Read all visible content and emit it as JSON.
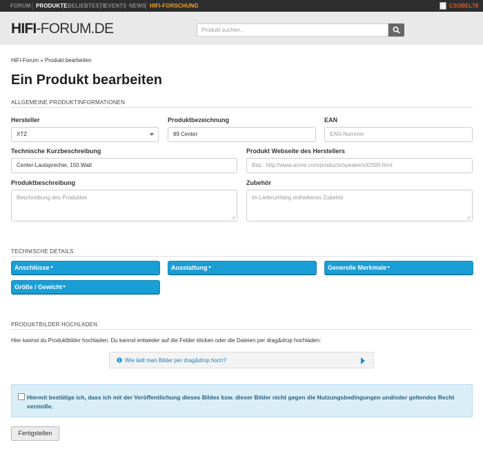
{
  "topnav": {
    "items": [
      {
        "label": "Forum",
        "state": "normal"
      },
      {
        "label": "Produkte",
        "state": "active"
      },
      {
        "label": "Beliebteste",
        "state": "normal"
      },
      {
        "label": "Events",
        "state": "normal"
      },
      {
        "label": "News",
        "state": "normal"
      },
      {
        "label": "HiFi-Forschung",
        "state": "highlight"
      }
    ],
    "username": "CSOBEL78"
  },
  "header": {
    "logo_bold": "HIFI",
    "logo_light": "-FORUM.DE",
    "search_placeholder": "Produkt suchen..."
  },
  "breadcrumb": {
    "home": "HiFi-Forum",
    "separator": "»",
    "current": "Produkt bearbeiten"
  },
  "page_title": "Ein Produkt bearbeiten",
  "sections": {
    "general": "Allgemeine Produktinformationen",
    "technical": "Technische Details",
    "images": "Produktbilder hochladen"
  },
  "form": {
    "hersteller": {
      "label": "Hersteller",
      "value": "XTZ"
    },
    "produktbezeichnung": {
      "label": "Produktbezeichnung",
      "value": "89 Center"
    },
    "ean": {
      "label": "EAN",
      "placeholder": "EAN-Nummer"
    },
    "kurzbeschreibung": {
      "label": "Technische Kurzbeschreibung",
      "value": "Center-Lautsprecher, 150 Watt"
    },
    "webseite": {
      "label": "Produkt Webseite des Herstellers",
      "placeholder": "Bsp.: http://www.acme.com/products/speakers/t2000.html"
    },
    "beschreibung": {
      "label": "Produktbeschreibung",
      "placeholder": "Beschreibung des Produktes"
    },
    "zubehoer": {
      "label": "Zubehör",
      "placeholder": "im Lieferumfang enthaltenes Zubehör"
    }
  },
  "technical_buttons": [
    {
      "label": "Anschlüsse"
    },
    {
      "label": "Ausstattung"
    },
    {
      "label": "Generelle Merkmale"
    },
    {
      "label": "Größe / Gewicht"
    }
  ],
  "upload": {
    "text": "Hier kannst du Produktbilder hochladen. Du kannst entweder auf die Felder klicken oder die Dateien per drag&drop hochladen:",
    "help_link": "Wie lädt man Bilder per drag&drop hoch?"
  },
  "consent": {
    "text": "Hiermit bestätige ich, dass ich mit der Veröffentlichung dieses Bildes bzw. dieser Bilder nicht gegen die Nutzungsbedingungen und/oder geltendes Recht verstoße."
  },
  "finish_label": "Fertigstellen",
  "colors": {
    "accent": "#1a9ed6",
    "nav_bg": "#2d2d2d",
    "highlight": "#f5a623",
    "username": "#e05a2a",
    "consent_bg": "#daeef7"
  }
}
